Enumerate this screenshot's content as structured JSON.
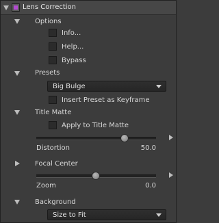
{
  "header": {
    "title": "Lens Correction"
  },
  "options": {
    "label": "Options",
    "items": [
      {
        "label": "Info..."
      },
      {
        "label": "Help..."
      },
      {
        "label": "Bypass"
      }
    ]
  },
  "presets": {
    "label": "Presets",
    "selected": "Big Bulge",
    "keyframe_label": "Insert Preset as Keyframe"
  },
  "title_matte": {
    "label": "Title Matte",
    "apply_label": "Apply to Title Matte",
    "distortion_label": "Distortion",
    "distortion_value": "50.0",
    "distortion_fraction": 0.75
  },
  "focal_center": {
    "label": "Focal Center",
    "zoom_label": "Zoom",
    "zoom_value": "0.0",
    "zoom_fraction": 0.5
  },
  "background": {
    "label": "Background",
    "selected": "Size to Fit"
  },
  "colors": {
    "accent_icon": "#b44ad2"
  }
}
